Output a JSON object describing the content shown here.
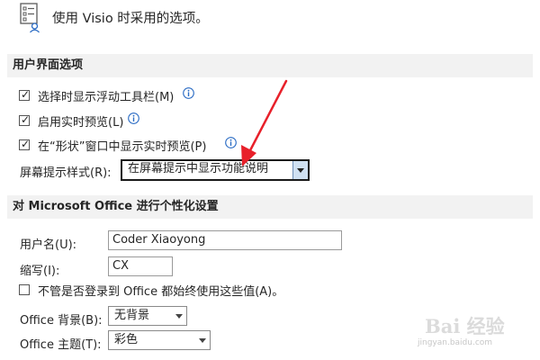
{
  "header": {
    "title": "使用 Visio 时采用的选项。"
  },
  "ui_section": {
    "title": "用户界面选项",
    "options": [
      {
        "label": "选择时显示浮动工具栏(M)",
        "checked": true
      },
      {
        "label": "启用实时预览(L)",
        "checked": true
      },
      {
        "label": "在“形状”窗口中显示实时预览(P)",
        "checked": true
      }
    ],
    "screentip": {
      "label": "屏幕提示样式(R):",
      "value": "在屏幕提示中显示功能说明"
    }
  },
  "personalize_section": {
    "title": "对 Microsoft Office 进行个性化设置",
    "username": {
      "label": "用户名(U):",
      "value": "Coder Xiaoyong"
    },
    "initials": {
      "label": "缩写(I):",
      "value": "CX"
    },
    "always_use": {
      "label": "不管是否登录到 Office 都始终使用这些值(A)。",
      "checked": false
    },
    "background": {
      "label": "Office 背景(B):",
      "value": "无背景"
    },
    "theme": {
      "label": "Office 主题(T):",
      "value": "彩色"
    }
  },
  "watermark": {
    "text": "Bai 经验",
    "sub": "jingyan.baidu.com"
  },
  "colors": {
    "section_bg": "#f2f2f2",
    "info_icon": "#2b6cc4",
    "annotation_arrow": "#e8202a",
    "focused_dropdown_button": "#cfe0f2"
  }
}
